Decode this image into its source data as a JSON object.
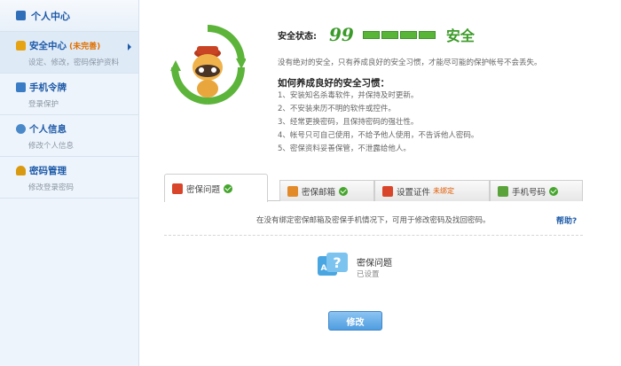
{
  "sidebar": {
    "header": "个人中心",
    "items": [
      {
        "title": "安全中心",
        "badge": "(未完善)",
        "sub": "设定、修改，密码保护资料",
        "icon": "lock-icon"
      },
      {
        "title": "手机令牌",
        "badge": "",
        "sub": "登录保护",
        "icon": "token-icon"
      },
      {
        "title": "个人信息",
        "badge": "",
        "sub": "修改个人信息",
        "icon": "user-icon"
      },
      {
        "title": "密码管理",
        "badge": "",
        "sub": "修改登录密码",
        "icon": "key-icon"
      }
    ]
  },
  "status": {
    "label": "安全状态:",
    "score": "99",
    "level_text": "安全",
    "level_bars": 4,
    "color": "#3a9a27"
  },
  "desc": "没有绝对的安全，只有养成良好的安全习惯，才能尽可能的保护帐号不会丢失。",
  "tips": {
    "title": "如何养成良好的安全习惯：",
    "items": [
      "1、安装知名杀毒软件，并保持及时更新。",
      "2、不安装来历不明的软件或控件。",
      "3、经常更换密码，且保持密码的强壮性。",
      "4、帐号只可自己使用，不给予他人使用，不告诉他人密码。",
      "5、密保资料妥善保管，不泄露给他人。"
    ]
  },
  "tabs": [
    {
      "label": "密保问题",
      "status": "done"
    },
    {
      "label": "密保邮箱",
      "status": "done"
    },
    {
      "label": "设置证件",
      "status": "未绑定"
    },
    {
      "label": "手机号码",
      "status": "done"
    }
  ],
  "panel": {
    "note": "在没有绑定密保邮箱及密保手机情况下，可用于修改密码及找回密码。",
    "help": "帮助?",
    "item_title": "密保问题",
    "item_status": "已设置",
    "button": "修改"
  }
}
